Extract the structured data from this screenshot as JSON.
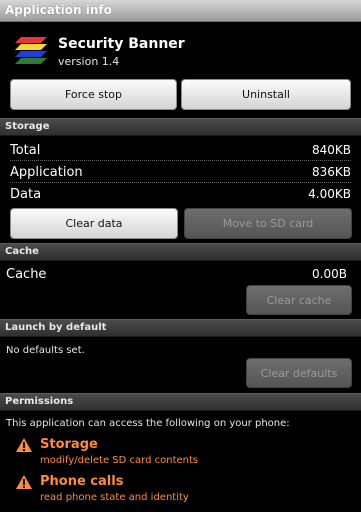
{
  "window": {
    "title": "Application info"
  },
  "app": {
    "name": "Security Banner",
    "version": "version 1.4"
  },
  "top_buttons": {
    "force_stop": "Force stop",
    "uninstall": "Uninstall"
  },
  "storage": {
    "header": "Storage",
    "rows": [
      {
        "label": "Total",
        "value": "840KB"
      },
      {
        "label": "Application",
        "value": "836KB"
      },
      {
        "label": "Data",
        "value": "4.00KB"
      }
    ],
    "clear_data": "Clear data",
    "move_to_sd": "Move to SD card"
  },
  "cache": {
    "header": "Cache",
    "label": "Cache",
    "value": "0.00B",
    "clear_cache": "Clear cache"
  },
  "launch_default": {
    "header": "Launch by default",
    "text": "No defaults set.",
    "clear_defaults": "Clear defaults"
  },
  "permissions": {
    "header": "Permissions",
    "intro": "This application can access the following on your phone:",
    "items": [
      {
        "title": "Storage",
        "desc": "modify/delete SD card contents",
        "icon": "warning-icon"
      },
      {
        "title": "Phone calls",
        "desc": "read phone state and identity",
        "icon": "warning-icon"
      }
    ]
  },
  "colors": {
    "accent_orange": "#ff8a3c",
    "section_bg": "#3a3a3a"
  }
}
